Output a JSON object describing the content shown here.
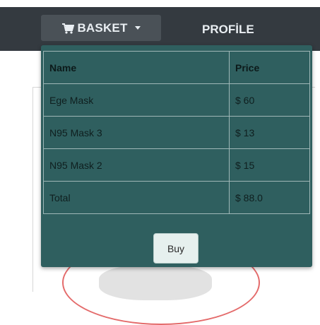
{
  "navbar": {
    "basket_label": "BASKET",
    "profile_label": "PROFİLE"
  },
  "basket": {
    "headers": {
      "name": "Name",
      "price": "Price"
    },
    "items": [
      {
        "name": "Ege Mask",
        "price": "$ 60"
      },
      {
        "name": "N95 Mask 3",
        "price": "$ 13"
      },
      {
        "name": "N95 Mask 2",
        "price": "$ 15"
      }
    ],
    "total": {
      "label": "Total",
      "price": "$ 88.0"
    },
    "buy_label": "Buy"
  },
  "colors": {
    "navbar": "#343a40",
    "dropdown": "#2f5f5f",
    "button": "#e6f0ee"
  },
  "icons": {
    "basket": "shopping-cart-icon",
    "dropdown": "caret-down-icon"
  }
}
